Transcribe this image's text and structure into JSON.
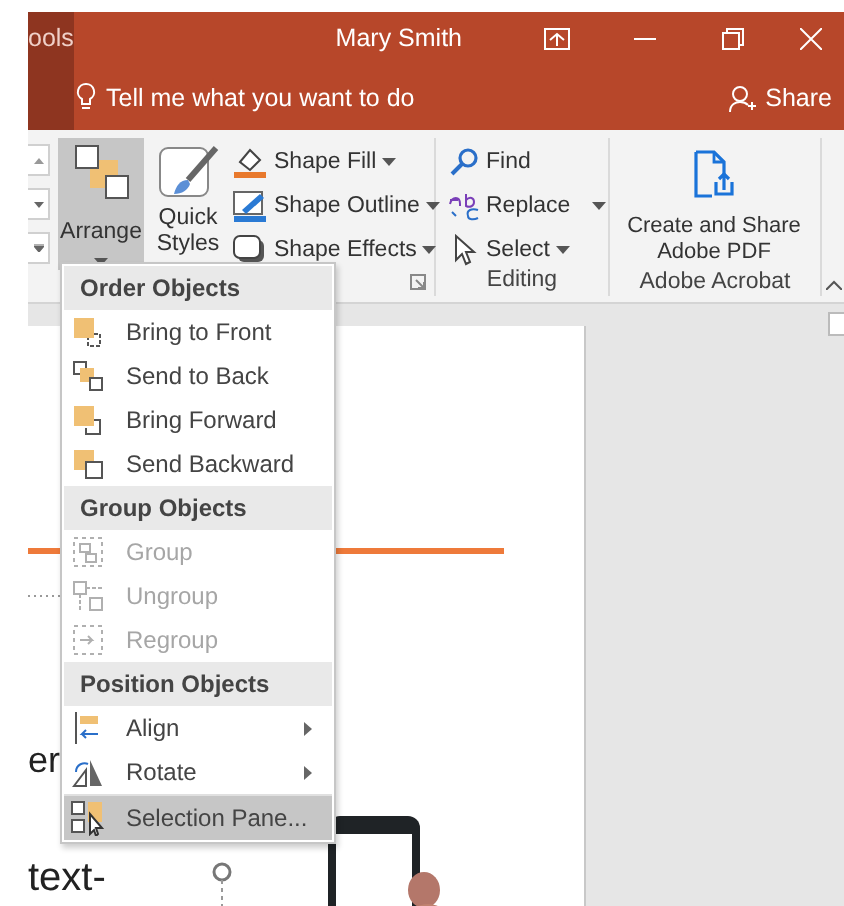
{
  "title_bar": {
    "tab_fragment": "ools",
    "user": "Mary Smith"
  },
  "tell_me": {
    "placeholder": "Tell me what you want to do",
    "share": "Share"
  },
  "ribbon": {
    "arrange": {
      "label": "Arrange",
      "selected": true
    },
    "quick_styles": {
      "label": "Quick Styles"
    },
    "shape_commands": [
      {
        "kind": "fill",
        "label": "Shape Fill"
      },
      {
        "kind": "outline",
        "label": "Shape Outline"
      },
      {
        "kind": "effects",
        "label": "Shape Effects"
      }
    ],
    "editing": {
      "label": "Editing",
      "commands": [
        {
          "kind": "find",
          "label": "Find",
          "dropdown": false
        },
        {
          "kind": "replace",
          "label": "Replace",
          "dropdown": true
        },
        {
          "kind": "select",
          "label": "Select",
          "dropdown": true
        }
      ]
    },
    "acrobat": {
      "label": "Adobe Acrobat",
      "command": "Create and Share Adobe PDF"
    }
  },
  "arrange_menu": [
    {
      "title": "Order Objects",
      "items": [
        {
          "kind": "bring-front",
          "label": "Bring to Front",
          "disabled": false,
          "submenu": false,
          "selected": false
        },
        {
          "kind": "send-back",
          "label": "Send to Back",
          "disabled": false,
          "submenu": false,
          "selected": false
        },
        {
          "kind": "bring-forward",
          "label": "Bring Forward",
          "disabled": false,
          "submenu": false,
          "selected": false
        },
        {
          "kind": "send-backward",
          "label": "Send Backward",
          "disabled": false,
          "submenu": false,
          "selected": false
        }
      ]
    },
    {
      "title": "Group Objects",
      "items": [
        {
          "kind": "group",
          "label": "Group",
          "disabled": true,
          "submenu": false,
          "selected": false
        },
        {
          "kind": "ungroup",
          "label": "Ungroup",
          "disabled": true,
          "submenu": false,
          "selected": false
        },
        {
          "kind": "regroup",
          "label": "Regroup",
          "disabled": true,
          "submenu": false,
          "selected": false
        }
      ]
    },
    {
      "title": "Position Objects",
      "items": [
        {
          "kind": "align",
          "label": "Align",
          "disabled": false,
          "submenu": true,
          "selected": false
        },
        {
          "kind": "rotate",
          "label": "Rotate",
          "disabled": false,
          "submenu": true,
          "selected": false
        },
        {
          "kind": "selection-pane",
          "label": "Selection Pane...",
          "disabled": false,
          "submenu": false,
          "selected": true
        }
      ]
    }
  ],
  "slide": {
    "texts": [
      "er",
      "text-"
    ]
  }
}
